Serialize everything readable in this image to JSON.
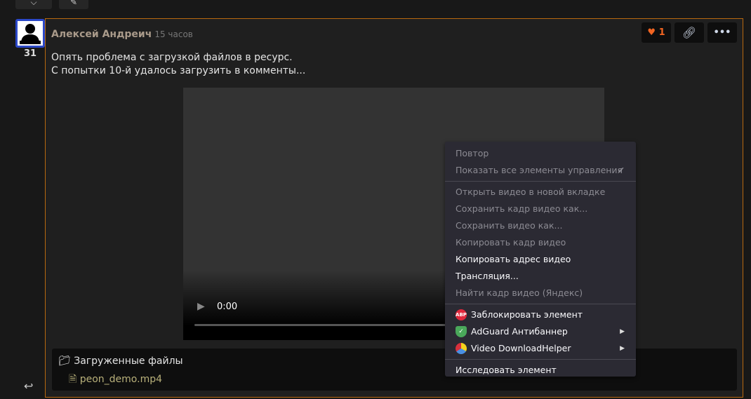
{
  "post": {
    "author": "Алексей Андреич",
    "time": "15 часов",
    "score": "31",
    "likes": "1",
    "lines": [
      "Опять проблема с загрузкой файлов в ресурс.",
      "С попытки 10-й удалось загрузить в комменты..."
    ]
  },
  "video": {
    "time": "0:00"
  },
  "files": {
    "header": "Загруженные файлы",
    "file": "peon_demo.mp4"
  },
  "menu": {
    "items": [
      "Повтор",
      "Показать все элементы управления",
      "Открыть видео в новой вкладке",
      "Сохранить кадр видео как...",
      "Сохранить видео как...",
      "Копировать кадр видео",
      "Копировать адрес видео",
      "Трансляция...",
      "Найти кадр видео (Яндекс)",
      "Заблокировать элемент",
      "AdGuard Антибаннер",
      "Video DownloadHelper",
      "Исследовать элемент"
    ],
    "abp": "ABP"
  },
  "colors": {
    "accent": "#b8680f",
    "like": "#f26522",
    "avatar_border": "#2b48c8"
  }
}
